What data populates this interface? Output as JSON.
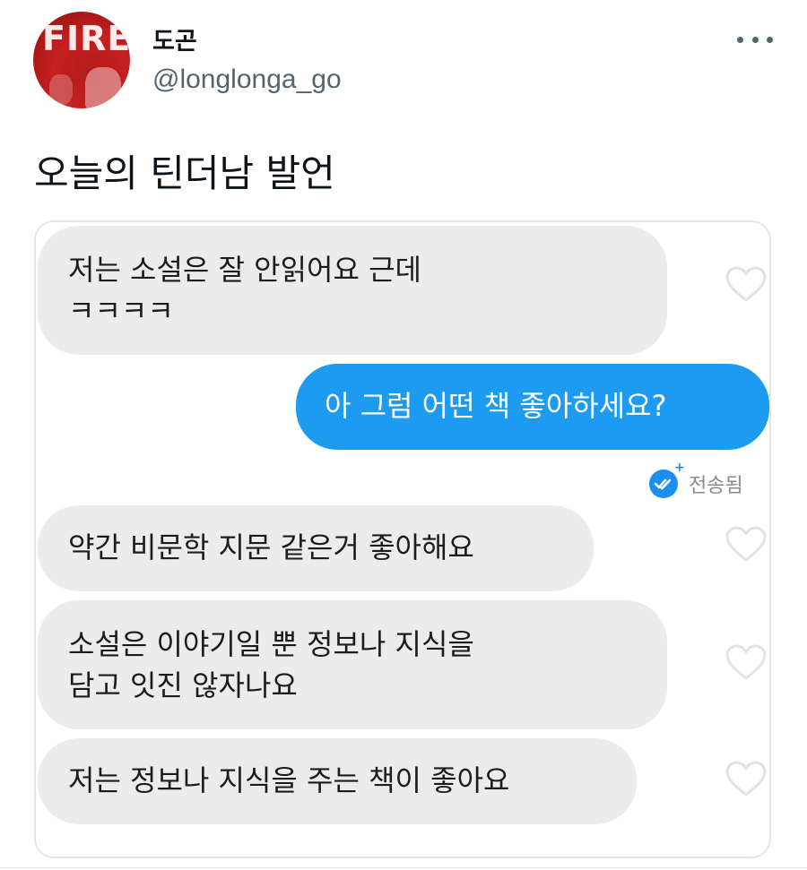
{
  "tweet": {
    "author": {
      "display_name": "도곤",
      "handle": "@longlonga_go",
      "avatar_text": "FIRE"
    },
    "text": "오늘의 틴더남 발언",
    "more_icon": "more-horizontal-icon"
  },
  "chat": {
    "messages": [
      {
        "side": "received",
        "text": "저는 소설은 잘 안읽어요 근데\nㅋㅋㅋㅋ"
      },
      {
        "side": "sent",
        "text": "아 그럼 어떤 책 좋아하세요?"
      },
      {
        "side": "received",
        "text": "약간 비문학 지문 같은거 좋아해요"
      },
      {
        "side": "received",
        "text": "소설은 이야기일 뿐 정보나 지식을\n담고 잇진 않자나요"
      },
      {
        "side": "received",
        "text": "저는 정보나 지식을 주는 책이 좋아요"
      }
    ],
    "sent_status": "전송됨",
    "colors": {
      "sent_bubble": "#1d9bf0",
      "received_bubble": "#ececec"
    }
  }
}
